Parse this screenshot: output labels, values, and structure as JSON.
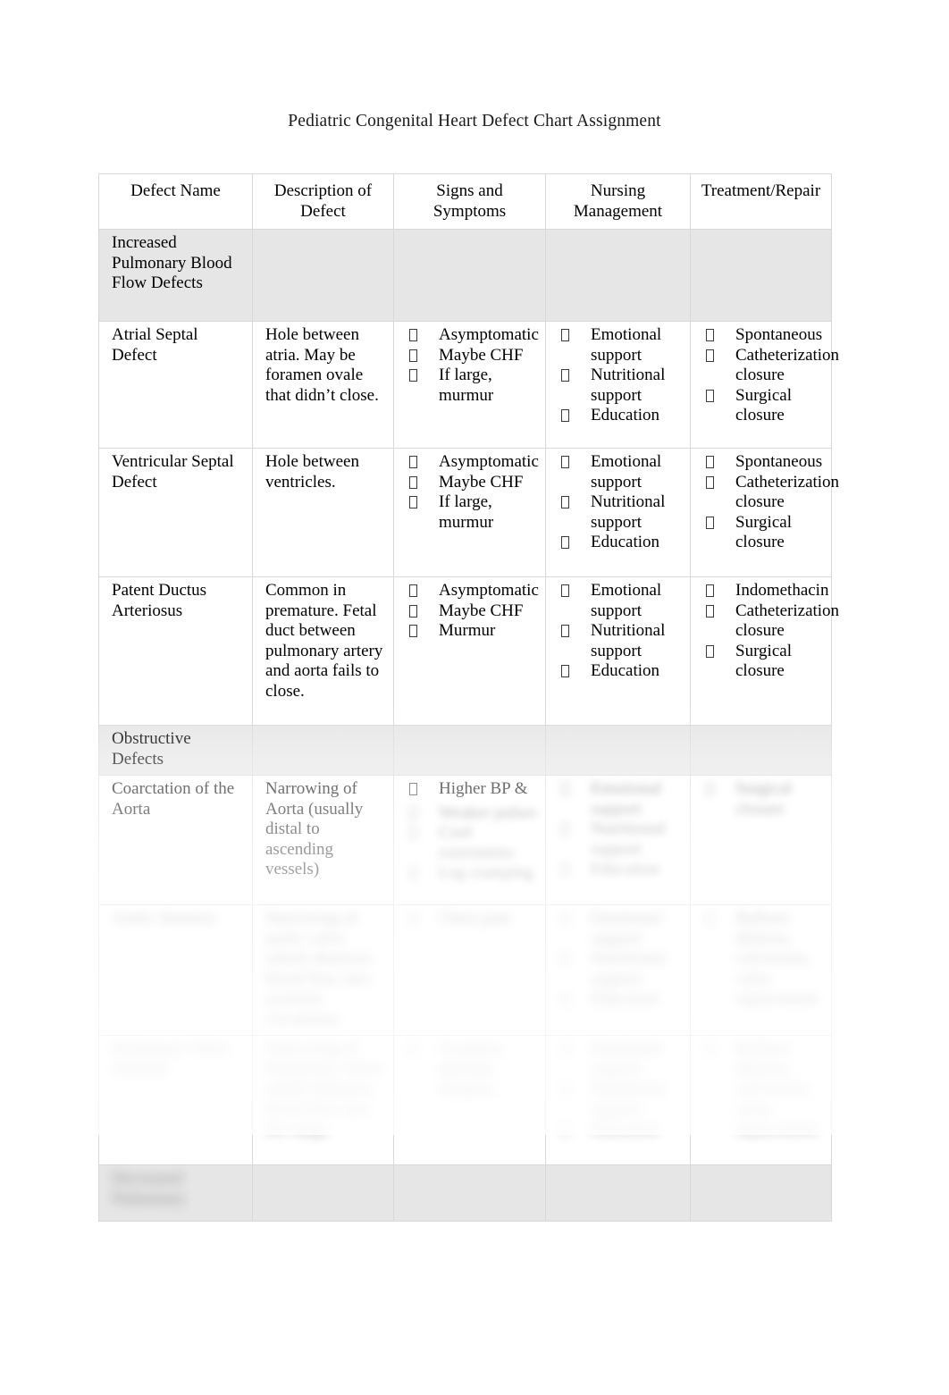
{
  "document": {
    "title": "Pediatric Congenital Heart Defect Chart Assignment"
  },
  "table": {
    "headers": {
      "defect_name": "Defect Name",
      "description": "Description of Defect",
      "signs_symptoms": "Signs and Symptoms",
      "nursing_management": "Nursing Management",
      "treatment_repair": "Treatment/Repair"
    },
    "sections": [
      {
        "label": "Increased Pulmonary Blood Flow Defects"
      },
      {
        "label": "Obstructive Defects"
      },
      {
        "label": ""
      }
    ],
    "rows": [
      {
        "defect_name": "Atrial Septal Defect",
        "description": "Hole between atria. May be foramen ovale that didn’t close.",
        "signs_symptoms": [
          "Asymptomatic",
          "Maybe CHF",
          "If large, murmur"
        ],
        "nursing_management": [
          "Emotional support",
          "Nutritional support",
          "Education"
        ],
        "treatment_repair": [
          "Spontaneous",
          "Catheterization closure",
          "Surgical closure"
        ]
      },
      {
        "defect_name": "Ventricular Septal Defect",
        "description": "Hole between ventricles.",
        "signs_symptoms": [
          "Asymptomatic",
          "Maybe CHF",
          "If large, murmur"
        ],
        "nursing_management": [
          "Emotional support",
          "Nutritional support",
          "Education"
        ],
        "treatment_repair": [
          "Spontaneous",
          "Catheterization closure",
          "Surgical closure"
        ]
      },
      {
        "defect_name": "Patent Ductus Arteriosus",
        "description": "Common in premature. Fetal duct between pulmonary artery and aorta fails to close.",
        "signs_symptoms": [
          "Asymptomatic",
          "Maybe CHF",
          "Murmur"
        ],
        "nursing_management": [
          "Emotional support",
          "Nutritional support",
          "Education"
        ],
        "treatment_repair": [
          "Indomethacin",
          "Catheterization closure",
          "Surgical closure"
        ]
      },
      {
        "defect_name": "Coarctation of the Aorta",
        "description": "Narrowing of Aorta (usually distal to ascending vessels)",
        "signs_symptoms": [
          "Higher BP &"
        ],
        "nursing_management": [],
        "treatment_repair": []
      }
    ],
    "obscured_note": "remaining rows blurred in preview"
  },
  "bullet_glyph": " "
}
